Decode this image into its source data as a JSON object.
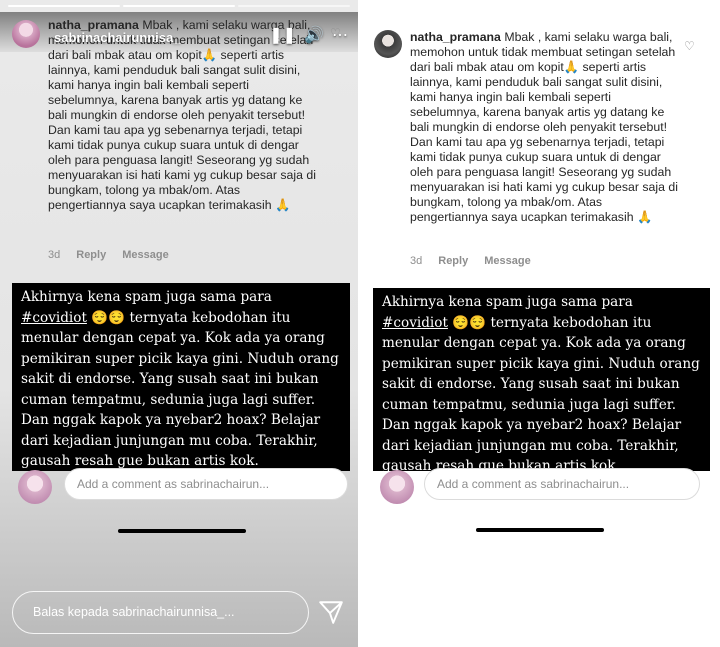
{
  "story": {
    "username": "sabrinachairunnisa_",
    "reply_placeholder": "Balas kepada sabrinachairunnisa_..."
  },
  "comment": {
    "username": "natha_pramana",
    "text": "Mbak , kami selaku warga bali, memohon untuk tidak membuat setingan setelah dari bali mbak atau om kopit🙏 seperti artis lainnya, kami penduduk bali sangat sulit disini, kami hanya ingin bali kembali seperti sebelumnya, karena banyak artis yg datang ke bali mungkin di endorse oleh penyakit tersebut! Dan kami tau apa yg sebenarnya terjadi, tetapi kami tidak punya cukup suara untuk di dengar oleh para penguasa langit! Seseorang yg sudah menyuarakan isi hati kami yg cukup besar saja di bungkam, tolong ya mbak/om. Atas pengertiannya saya ucapkan terimakasih 🙏",
    "time": "3d",
    "reply_label": "Reply",
    "message_label": "Message"
  },
  "caption": {
    "line1": "Akhirnya kena spam juga sama para",
    "hashtag": "#covidiot",
    "emoji": "😌😌",
    "rest": "ternyata kebodohan itu menular dengan cepat ya. Kok ada ya orang pemikiran super picik kaya gini. Nuduh orang sakit di endorse. Yang susah saat ini bukan cuman tempatmu, sedunia juga lagi suffer. Dan nggak kapok ya nyebar2 hoax? Belajar dari kejadian junjungan mu coba. Terakhir, gausah resah gue bukan artis kok."
  },
  "add_comment": {
    "placeholder": "Add a comment as sabrinachairun..."
  },
  "icons": {
    "heart": "heart-icon",
    "pause": "pause-icon",
    "sound": "sound-icon",
    "more": "more-icon",
    "send": "send-icon"
  }
}
